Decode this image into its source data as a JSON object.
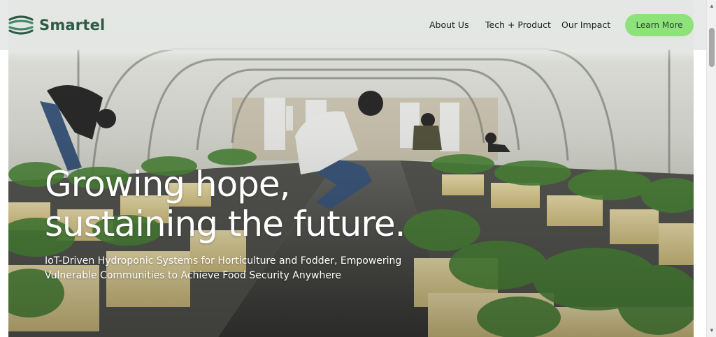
{
  "brand": {
    "name": "Smartel",
    "color": "#2e5a47"
  },
  "nav": {
    "about": "About Us",
    "tech": "Tech + Product",
    "impact": "Our Impact",
    "cta": "Learn More",
    "cta_color": "#8ee27a"
  },
  "hero": {
    "headline_line1": "Growing hope,",
    "headline_line2": "sustaining the future.",
    "subtitle_line1": "IoT-Driven Hydroponic Systems for Horticulture and Fodder, Empowering",
    "subtitle_line2": "Vulnerable Communities to Achieve Food Security Anywhere",
    "image": "greenhouse-hydroponic-photo"
  },
  "scrollbar": {
    "up_icon": "triangle-up-icon",
    "down_icon": "triangle-down-icon"
  }
}
